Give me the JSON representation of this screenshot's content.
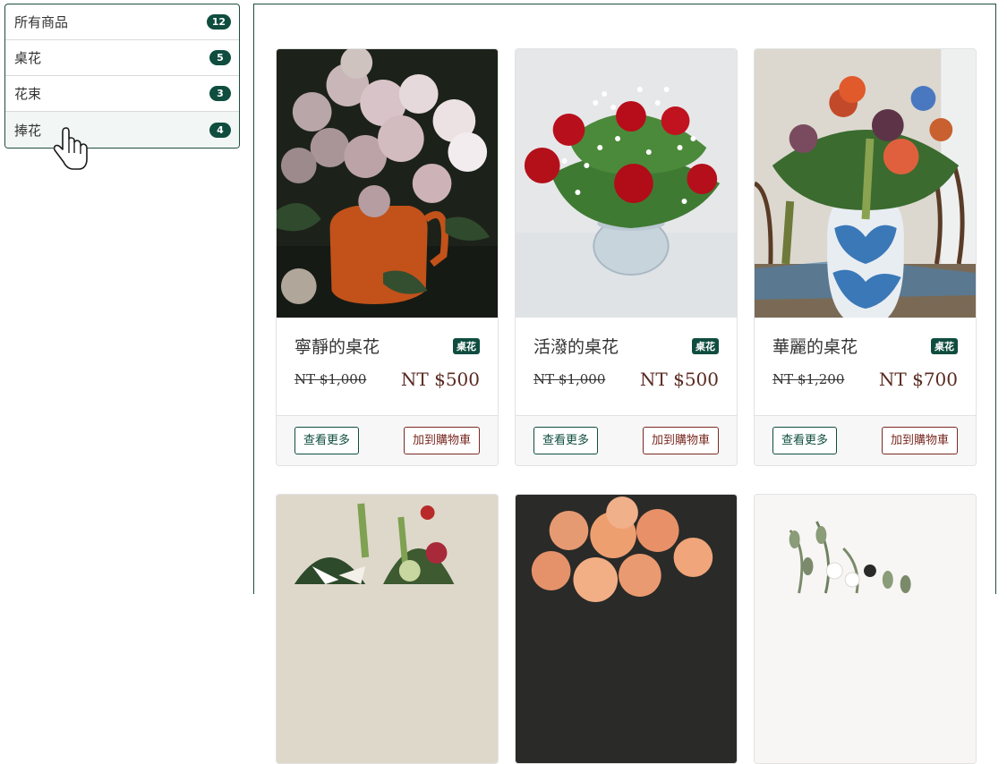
{
  "sidebar": {
    "categories": [
      {
        "label": "所有商品",
        "count": "12"
      },
      {
        "label": "桌花",
        "count": "5"
      },
      {
        "label": "花束",
        "count": "3"
      },
      {
        "label": "捧花",
        "count": "4"
      }
    ]
  },
  "products": [
    {
      "title": "寧靜的桌花",
      "tag": "桌花",
      "old_price": "NT $1,000",
      "price": "NT $500",
      "more_label": "查看更多",
      "cart_label": "加到購物車",
      "image": "pink roses in orange watering can"
    },
    {
      "title": "活潑的桌花",
      "tag": "桌花",
      "old_price": "NT $1,000",
      "price": "NT $500",
      "more_label": "查看更多",
      "cart_label": "加到購物車",
      "image": "red roses in glass bowl"
    },
    {
      "title": "華麗的桌花",
      "tag": "桌花",
      "old_price": "NT $1,200",
      "price": "NT $700",
      "more_label": "查看更多",
      "cart_label": "加到購物車",
      "image": "bouquet in blue-white porcelain vase"
    },
    {
      "image": "lilies and red flowers arrangement"
    },
    {
      "image": "peach roses on dark background"
    },
    {
      "image": "white flowers with greenery"
    }
  ],
  "colors": {
    "brand": "#0f4d3f",
    "price": "#5a2a22",
    "cart": "#7a2a22"
  }
}
